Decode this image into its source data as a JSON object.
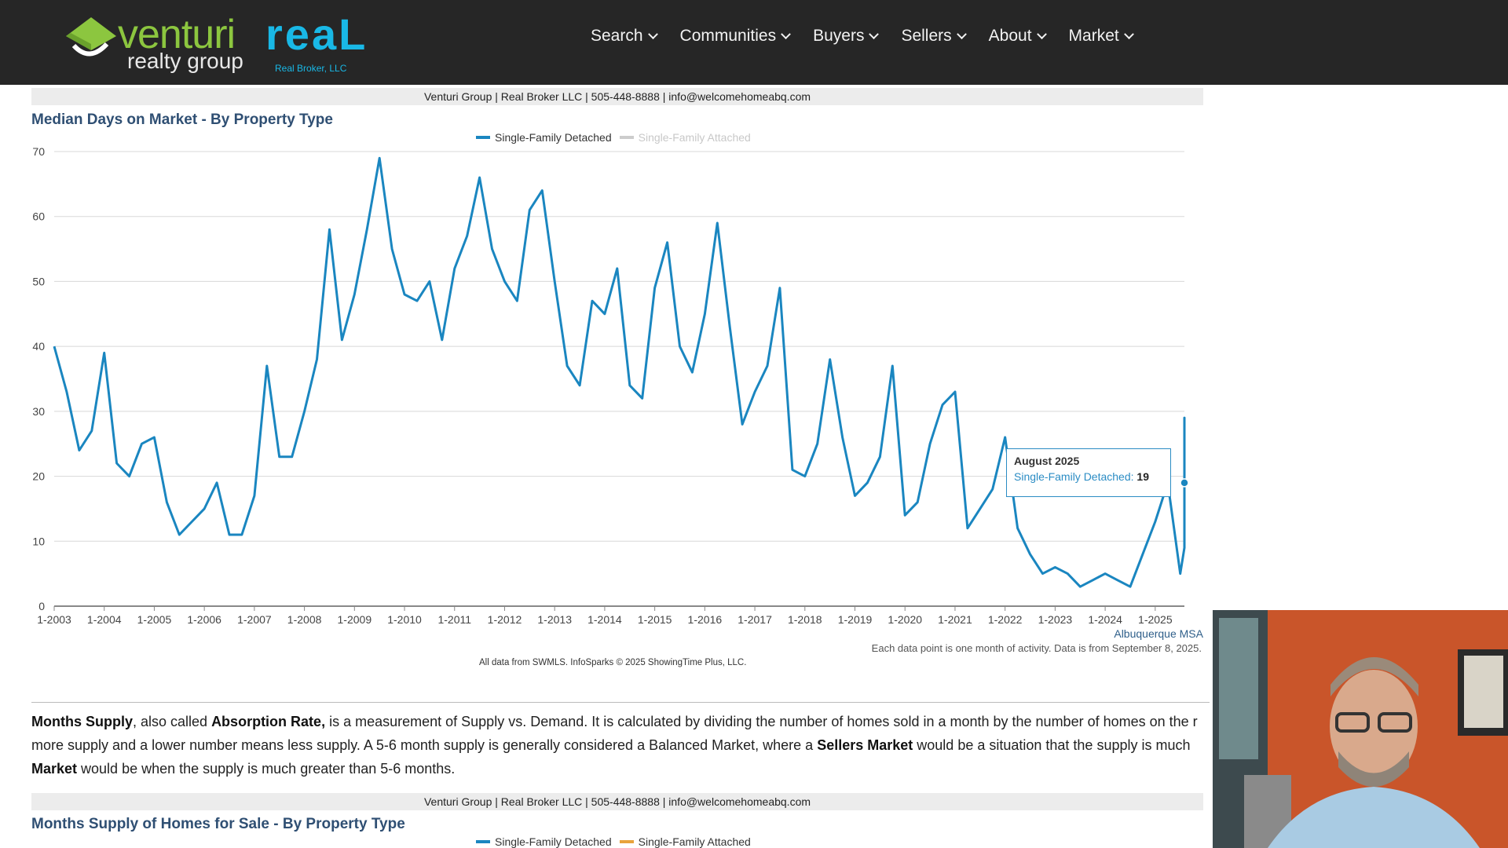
{
  "header": {
    "logo_venturi": "venturi",
    "logo_realty_group": "realty group",
    "logo_real": "reaL",
    "logo_real_broker": "Real Broker, LLC",
    "nav": [
      "Search",
      "Communities",
      "Buyers",
      "Sellers",
      "About",
      "Market"
    ]
  },
  "chart1": {
    "infobar": "Venturi Group | Real Broker LLC | 505-448-8888 | info@welcomehomeabq.com",
    "title": "Median Days on Market - By Property Type",
    "legend": [
      "Single-Family Detached",
      "Single-Family Attached"
    ],
    "region": "Albuquerque MSA",
    "note": "Each data point is one month of activity. Data is from September 8, 2025.",
    "source": "All data from SWMLS. InfoSparks © 2025 ShowingTime Plus, LLC.",
    "tooltip": {
      "date": "August 2025",
      "series": "Single-Family Detached:",
      "value": "19"
    }
  },
  "paragraph": {
    "t1": "Months Supply",
    "t2": ", also called ",
    "t3": "Absorption Rate,",
    "t4": " is a measurement of Supply vs. Demand. It is calculated by dividing the number of homes sold in a month by the number of homes on the r",
    "t5": "more supply and a lower number means less supply. A 5-6 month supply is generally considered a Balanced Market, where a ",
    "t6": "Sellers Market",
    "t7": " would be a situation that the supply is much",
    "t8": "Market",
    "t9": " would be when the supply is much greater than 5-6 months."
  },
  "chart2": {
    "infobar": "Venturi Group | Real Broker LLC | 505-448-8888 | info@welcomehomeabq.com",
    "title": "Months Supply of Homes for Sale - By Property Type",
    "legend": [
      "Single-Family Detached",
      "Single-Family Attached"
    ]
  },
  "colors": {
    "detached": "#1a86c0",
    "attached_inactive": "#cccccc",
    "attached": "#e8a33c",
    "title": "#2f4f73"
  },
  "chart_data": {
    "type": "line",
    "title": "Median Days on Market - By Property Type",
    "xlabel": "",
    "ylabel": "",
    "ylim": [
      0,
      70
    ],
    "yticks": [
      0,
      10,
      20,
      30,
      40,
      50,
      60,
      70
    ],
    "xticks": [
      "1-2003",
      "1-2004",
      "1-2005",
      "1-2006",
      "1-2007",
      "1-2008",
      "1-2009",
      "1-2010",
      "1-2011",
      "1-2012",
      "1-2013",
      "1-2014",
      "1-2015",
      "1-2016",
      "1-2017",
      "1-2018",
      "1-2019",
      "1-2020",
      "1-2021",
      "1-2022",
      "1-2023",
      "1-2024",
      "1-2025"
    ],
    "grid": true,
    "legend_position": "top-center",
    "series": [
      {
        "name": "Single-Family Detached",
        "x_start": "2003-01",
        "x_step_months": 3,
        "values": [
          40,
          33,
          24,
          27,
          39,
          22,
          20,
          25,
          26,
          16,
          11,
          13,
          15,
          19,
          11,
          11,
          17,
          37,
          23,
          23,
          30,
          38,
          58,
          41,
          48,
          58,
          69,
          55,
          48,
          47,
          50,
          41,
          52,
          57,
          66,
          55,
          50,
          47,
          61,
          64,
          50,
          37,
          34,
          47,
          45,
          52,
          34,
          32,
          49,
          56,
          40,
          36,
          45,
          59,
          43,
          28,
          33,
          37,
          49,
          21,
          20,
          25,
          38,
          26,
          17,
          19,
          23,
          37,
          14,
          16,
          25,
          31,
          33,
          12,
          15,
          18,
          26,
          12,
          8,
          5,
          6,
          5,
          3,
          4,
          5,
          4,
          3,
          8,
          13,
          19,
          5,
          9,
          25,
          9,
          11,
          18,
          29,
          16,
          14,
          19
        ]
      },
      {
        "name": "Single-Family Attached",
        "values": []
      }
    ]
  }
}
